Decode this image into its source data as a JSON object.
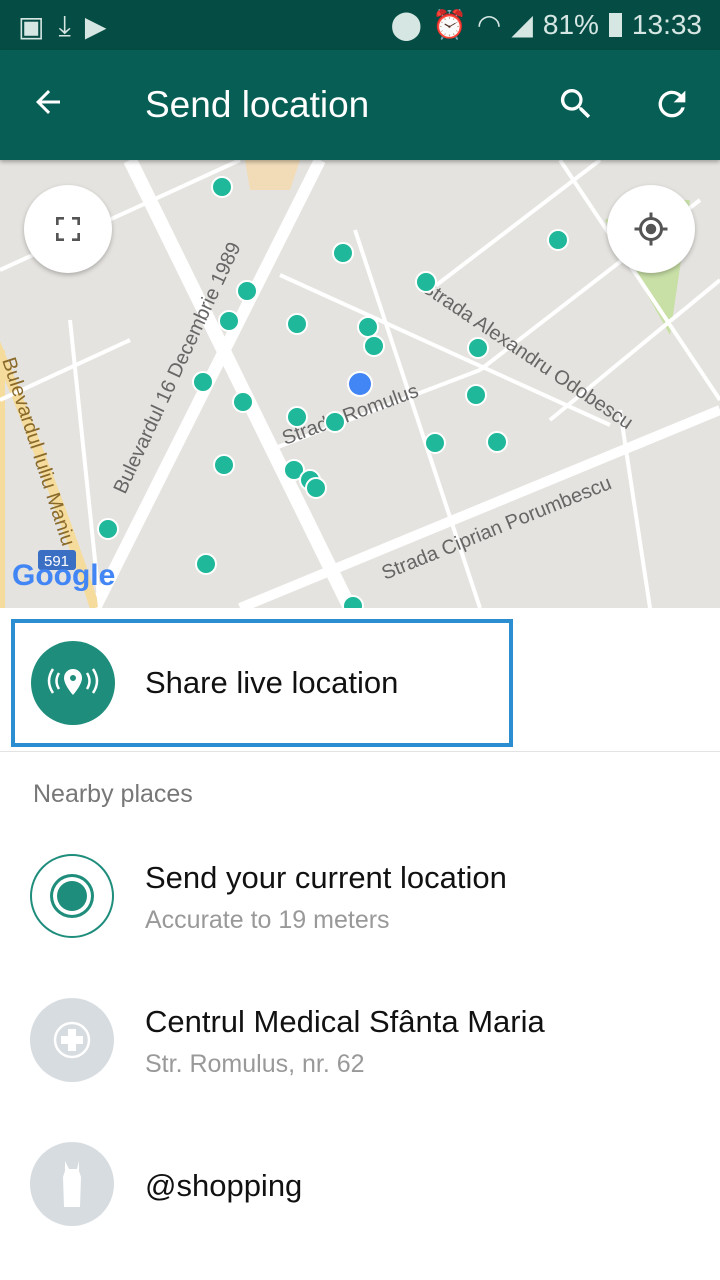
{
  "status_bar": {
    "battery": "81%",
    "time": "13:33"
  },
  "app_bar": {
    "title": "Send location",
    "icons": [
      "back-arrow-icon",
      "search-icon",
      "refresh-icon"
    ]
  },
  "map": {
    "streets": [
      "Strada Alexandru Odobescu",
      "Bulevardul 16 Decembrie 1989",
      "Bulevardul Iuliu Maniu",
      "Strada Romulus",
      "Strada Ciprian Porumbescu"
    ],
    "route_badge": "591",
    "attribution": "Google"
  },
  "share_live": {
    "label": "Share live location"
  },
  "nearby": {
    "header": "Nearby places",
    "items": [
      {
        "title": "Send your current location",
        "subtitle": "Accurate to 19 meters",
        "icon": "current-location-icon"
      },
      {
        "title": "Centrul Medical Sfânta Maria",
        "subtitle": "Str. Romulus, nr. 62",
        "icon": "medical-icon"
      },
      {
        "title": "@shopping",
        "subtitle": "",
        "icon": "dress-icon"
      }
    ]
  },
  "colors": {
    "app_bar": "#075e54",
    "status_bar": "#054d44",
    "accent": "#1e8d7c",
    "marker": "#1fb89a",
    "my_location": "#4285f4",
    "highlight": "#2a8ed0"
  }
}
